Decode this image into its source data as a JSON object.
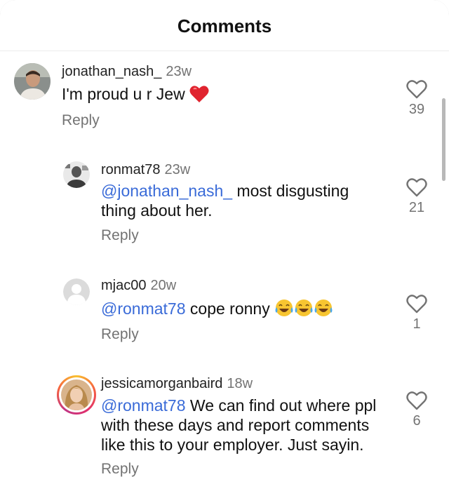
{
  "header": {
    "title": "Comments"
  },
  "comments": [
    {
      "username": "jonathan_nash_",
      "time": "23w",
      "text": "I'm proud u r Jew",
      "reply_label": "Reply",
      "likes": "39"
    },
    {
      "username": "ronmat78",
      "time": "23w",
      "mention": "@jonathan_nash_",
      "text_line1": " most disgusting",
      "text_line2": "thing about her.",
      "reply_label": "Reply",
      "likes": "21"
    },
    {
      "username": "mjac00",
      "time": "20w",
      "mention": "@ronmat78",
      "text": " cope ronny",
      "reply_label": "Reply",
      "likes": "1"
    },
    {
      "username": "jessicamorganbaird",
      "time": "18w",
      "mention": "@ronmat78",
      "text_line1": " We can find out where ppl",
      "text_line2": "with these days and report comments",
      "text_line3": "like this to your employer. Just sayin.",
      "reply_label": "Reply",
      "likes": "6"
    }
  ],
  "colors": {
    "mention": "#3a6bd8",
    "muted": "#737373",
    "heart_emoji": "#e0242f"
  },
  "icons": [
    "heart-outline-icon",
    "red-heart-emoji",
    "tears-of-joy-emoji",
    "default-avatar-icon"
  ]
}
